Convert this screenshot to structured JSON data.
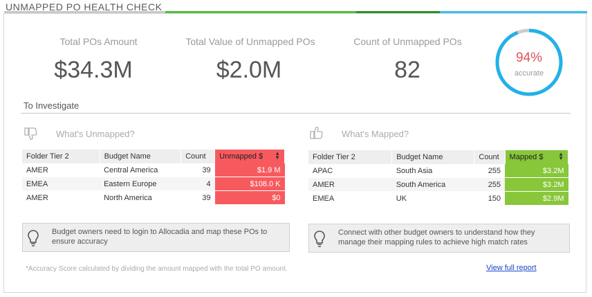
{
  "header": {
    "title": "UNMAPPED PO HEALTH CHECK"
  },
  "colors": {
    "bar_grey": "#c8c8c8",
    "bar_green": "#4fbf3a",
    "bar_dark_green": "#2f8f2a",
    "bar_blue": "#38c0ee",
    "unmapped_red": "#f75a5e",
    "mapped_green": "#88c63a",
    "gauge_blue": "#21b2e8",
    "gauge_grey": "#cccccc",
    "gauge_pct": "#e0525a"
  },
  "kpis": [
    {
      "label": "Total POs Amount",
      "value": "$34.3M"
    },
    {
      "label": "Total Value of Unmapped POs",
      "value": "$2.0M"
    },
    {
      "label": "Count of Unmapped POs",
      "value": "82"
    }
  ],
  "accuracy": {
    "percent_text": "94%",
    "label": "accurate",
    "fraction": 0.94
  },
  "investigate": {
    "title": "To Investigate"
  },
  "unmapped": {
    "heading": "What's Unmapped?",
    "icon": "thumbs-down-icon",
    "columns": [
      "Folder Tier 2",
      "Budget Name",
      "Count",
      "Unmapped $"
    ],
    "rows": [
      {
        "tier": "AMER",
        "budget": "Central America",
        "count": "39",
        "amount": "$1.9 M"
      },
      {
        "tier": "EMEA",
        "budget": "Eastern Europe",
        "count": "4",
        "amount": "$108.0 K"
      },
      {
        "tier": "AMER",
        "budget": "North America",
        "count": "39",
        "amount": "$0"
      }
    ],
    "tip": "Budget owners need to login to Allocadia and map these POs to ensure accuracy"
  },
  "mapped": {
    "heading": "What's Mapped?",
    "icon": "thumbs-up-icon",
    "columns": [
      "Folder Tier 2",
      "Budget Name",
      "Count",
      "Mapped $"
    ],
    "rows": [
      {
        "tier": "APAC",
        "budget": "South Asia",
        "count": "255",
        "amount": "$3.2M"
      },
      {
        "tier": "AMER",
        "budget": "South America",
        "count": "255",
        "amount": "$3.2M"
      },
      {
        "tier": "EMEA",
        "budget": "UK",
        "count": "150",
        "amount": "$2.9M"
      }
    ],
    "tip": "Connect with other budget owners to understand how they manage their mapping rules to achieve high match rates"
  },
  "footer": {
    "note": "*Accuracy Score calculated by dividing the amount mapped with the total PO amount.",
    "link": "View full report"
  }
}
